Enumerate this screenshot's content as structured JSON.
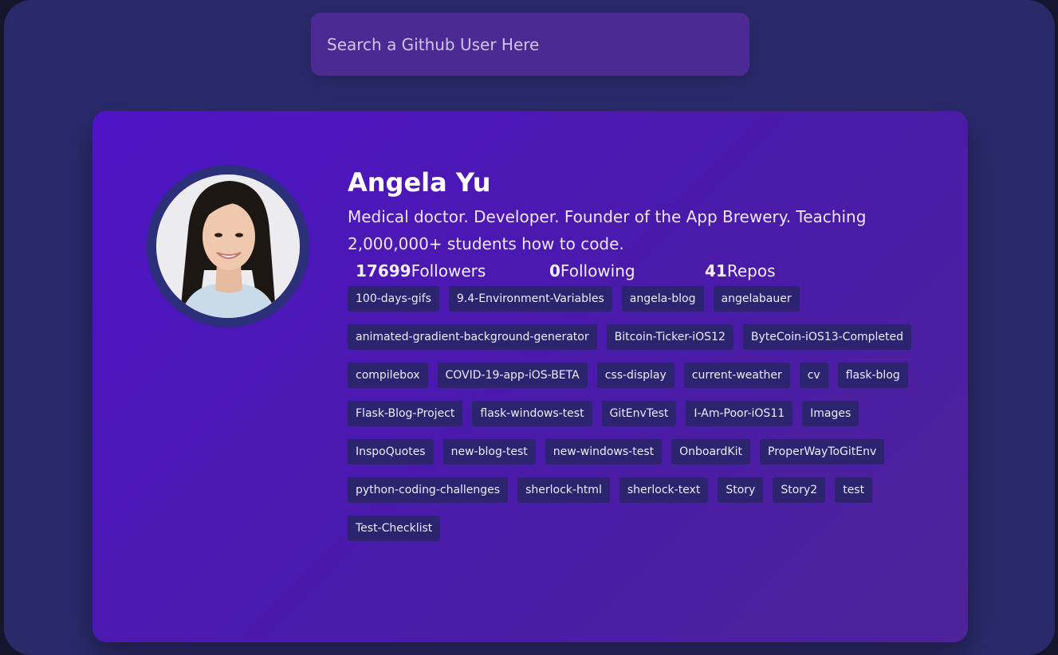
{
  "search": {
    "placeholder": "Search a Github User Here"
  },
  "profile": {
    "name": "Angela Yu",
    "bio": "Medical doctor. Developer. Founder of the App Brewery. Teaching 2,000,000+ students how to code.",
    "followers_count": "17699",
    "followers_label": "Followers",
    "following_count": "0",
    "following_label": "Following",
    "repos_count": "41",
    "repos_label": "Repos"
  },
  "repos": [
    "100-days-gifs",
    "9.4-Environment-Variables",
    "angela-blog",
    "angelabauer",
    "animated-gradient-background-generator",
    "Bitcoin-Ticker-iOS12",
    "ByteCoin-iOS13-Completed",
    "compilebox",
    "COVID-19-app-iOS-BETA",
    "css-display",
    "current-weather",
    "cv",
    "flask-blog",
    "Flask-Blog-Project",
    "flask-windows-test",
    "GitEnvTest",
    "I-Am-Poor-iOS11",
    "Images",
    "InspoQuotes",
    "new-blog-test",
    "new-windows-test",
    "OnboardKit",
    "ProperWayToGitEnv",
    "python-coding-challenges",
    "sherlock-html",
    "sherlock-text",
    "Story",
    "Story2",
    "test",
    "Test-Checklist"
  ],
  "colors": {
    "background": "#2a2a6b",
    "card": "#4e14c6",
    "search_bg": "#4b2b93",
    "repo_tag": "#2d2470",
    "avatar_ring": "#2c2f7a"
  }
}
